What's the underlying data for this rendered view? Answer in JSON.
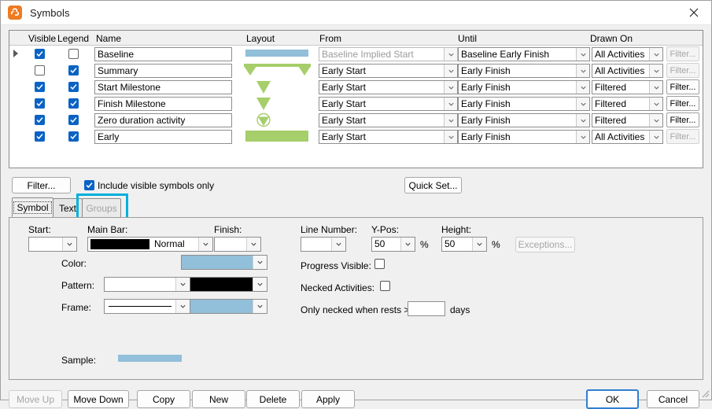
{
  "window": {
    "title": "Symbols",
    "app_icon": "symbols-app-icon",
    "close_icon": "close-icon"
  },
  "table": {
    "columns": [
      "Visible",
      "Legend",
      "Name",
      "Layout",
      "From",
      "Until",
      "Drawn On"
    ],
    "rows": [
      {
        "selected": true,
        "visible": true,
        "legend": false,
        "name": "Baseline",
        "layout": "bar-blue",
        "from": "Baseline Implied Start",
        "from_disabled": true,
        "until": "Baseline Early Finish",
        "drawn_on": "All Activities",
        "filter_label": "Filter...",
        "filter_disabled": true
      },
      {
        "selected": false,
        "visible": false,
        "legend": true,
        "name": "Summary",
        "layout": "summary-green",
        "from": "Early Start",
        "from_disabled": false,
        "until": "Early Finish",
        "drawn_on": "All Activities",
        "filter_label": "Filter...",
        "filter_disabled": true
      },
      {
        "selected": false,
        "visible": true,
        "legend": true,
        "name": "Start Milestone",
        "layout": "triangle-green",
        "from": "Early Start",
        "from_disabled": false,
        "until": "Early Finish",
        "drawn_on": "Filtered",
        "filter_label": "Filter...",
        "filter_disabled": false
      },
      {
        "selected": false,
        "visible": true,
        "legend": true,
        "name": "Finish Milestone",
        "layout": "triangle-green",
        "from": "Early Start",
        "from_disabled": false,
        "until": "Early Finish",
        "drawn_on": "Filtered",
        "filter_label": "Filter...",
        "filter_disabled": false
      },
      {
        "selected": false,
        "visible": true,
        "legend": true,
        "name": "Zero duration activity",
        "layout": "circle-triangle-green",
        "from": "Early Start",
        "from_disabled": false,
        "until": "Early Finish",
        "drawn_on": "Filtered",
        "filter_label": "Filter...",
        "filter_disabled": false
      },
      {
        "selected": false,
        "visible": true,
        "legend": true,
        "name": "Early",
        "layout": "bar-green",
        "from": "Early Start",
        "from_disabled": false,
        "until": "Early Finish",
        "drawn_on": "All Activities",
        "filter_label": "Filter...",
        "filter_disabled": true
      }
    ]
  },
  "midbar": {
    "filter_button": "Filter...",
    "include_visible_label": "Include visible symbols only",
    "include_visible_checked": true,
    "quick_set_button": "Quick Set..."
  },
  "tabs": [
    {
      "label": "Symbol",
      "active": true,
      "disabled": false
    },
    {
      "label": "Text",
      "active": false,
      "disabled": false
    },
    {
      "label": "Groups",
      "active": false,
      "disabled": true,
      "highlighted": true
    }
  ],
  "symbol_panel": {
    "start_label": "Start:",
    "start_value": "",
    "main_bar_label": "Main Bar:",
    "main_bar_value": "Normal",
    "finish_label": "Finish:",
    "finish_value": "",
    "color_label": "Color:",
    "color_value": "#92bfd9",
    "pattern_label": "Pattern:",
    "pattern_line_value": "",
    "pattern_color_value": "#000000",
    "frame_label": "Frame:",
    "frame_line_value": "solid-line",
    "frame_color_value": "#92bfd9",
    "line_number_label": "Line Number:",
    "line_number_value": "",
    "ypos_label": "Y-Pos:",
    "ypos_value": "50",
    "ypos_unit": "%",
    "height_label": "Height:",
    "height_value": "50",
    "height_unit": "%",
    "exceptions_button": "Exceptions...",
    "exceptions_disabled": true,
    "progress_visible_label": "Progress Visible:",
    "progress_visible_checked": false,
    "necked_activities_label": "Necked Activities:",
    "necked_activities_checked": false,
    "only_necked_label": "Only necked when rests >",
    "only_necked_value": "",
    "only_necked_unit": "days",
    "sample_label": "Sample:",
    "sample_color": "#92bfd9"
  },
  "footer": {
    "move_up": "Move Up",
    "move_up_disabled": true,
    "move_down": "Move Down",
    "copy": "Copy",
    "new": "New",
    "delete": "Delete",
    "apply": "Apply",
    "ok": "OK",
    "cancel": "Cancel"
  },
  "colors": {
    "bar_blue": "#92bfd9",
    "bar_green": "#a6ce6a",
    "accent_blue": "#0a63c4",
    "highlight_cyan": "#00b0dc",
    "title_orange": "#ee7b22"
  }
}
